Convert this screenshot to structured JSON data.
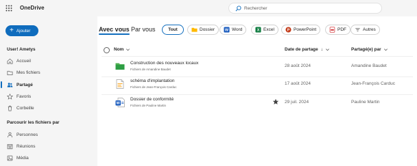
{
  "app": {
    "title": "OneDrive"
  },
  "search": {
    "placeholder": "Rechercher"
  },
  "sidebar": {
    "add_label": "Ajouter",
    "user_heading": "User! Ametys",
    "items": [
      {
        "label": "Accueil",
        "icon": "home-icon"
      },
      {
        "label": "Mes fichiers",
        "icon": "folder-icon"
      },
      {
        "label": "Partagé",
        "icon": "people-icon",
        "active": true
      },
      {
        "label": "Favoris",
        "icon": "star-icon"
      },
      {
        "label": "Corbeille",
        "icon": "trash-icon"
      }
    ],
    "browse_heading": "Parcourir les fichiers par",
    "browse_items": [
      {
        "label": "Personnes",
        "icon": "person-icon"
      },
      {
        "label": "Réunions",
        "icon": "calendar-icon"
      },
      {
        "label": "Média",
        "icon": "image-icon"
      }
    ]
  },
  "tabs": [
    {
      "label": "Avec vous",
      "active": true
    },
    {
      "label": "Par vous",
      "active": false
    }
  ],
  "filters": [
    {
      "label": "Tout",
      "icon": "",
      "selected": true
    },
    {
      "label": "Dossier",
      "icon": "folder-icon"
    },
    {
      "label": "Word",
      "icon": "word-icon"
    },
    {
      "label": "Excel",
      "icon": "excel-icon"
    },
    {
      "label": "PowerPoint",
      "icon": "powerpoint-icon"
    },
    {
      "label": "PDF",
      "icon": "pdf-icon"
    },
    {
      "label": "Autres",
      "icon": "filter-icon"
    }
  ],
  "table": {
    "columns": {
      "name": "Nom",
      "date": "Date de partage",
      "shared_by": "Partagé(e) par"
    },
    "rows": [
      {
        "name": "Construction des nouveaux locaux",
        "subtitle": "Fichiers de Amandine Baudet",
        "date": "28 août 2024",
        "shared_by": "Amandine Baudet",
        "type": "folder",
        "favorite": false
      },
      {
        "name": "schéma d'implantation",
        "subtitle": "Fichiers de Jean-François Carduc",
        "date": "17 août 2024",
        "shared_by": "Jean-François Carduc",
        "type": "image",
        "favorite": false
      },
      {
        "name": "Dossier de conformité",
        "subtitle": "Fichiers de Pauline Martin",
        "date": "29 juil. 2024",
        "shared_by": "Pauline Martin",
        "type": "word",
        "favorite": true
      }
    ]
  },
  "colors": {
    "accent": "#0f6cbd",
    "sidebar_bg": "#f5f5f5",
    "folder": "#4caf50",
    "word": "#185abd",
    "excel": "#107c41",
    "powerpoint": "#c43e1c",
    "pdf": "#d13438"
  }
}
